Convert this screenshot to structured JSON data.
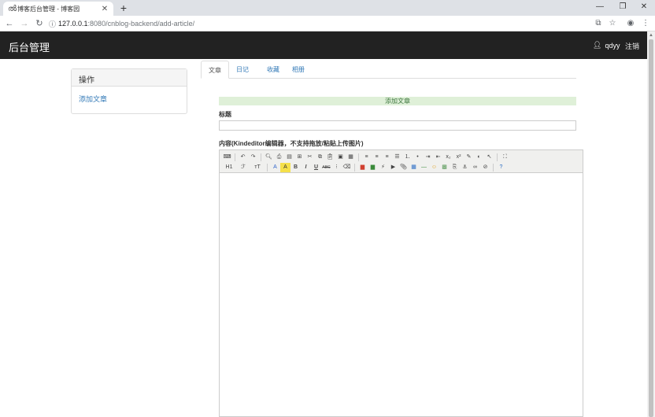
{
  "browser": {
    "tab_title": "博客后台管理 - 博客园",
    "tab_favicon": "cnblog-icon",
    "url_host": "127.0.0.1",
    "url_path": ":8080/cnblog-backend/add-article/",
    "icons": [
      "back-icon",
      "forward-icon",
      "reload-icon",
      "info-icon",
      "translate-icon",
      "star-icon",
      "account-icon",
      "menu-icon"
    ]
  },
  "navbar": {
    "brand": "后台管理",
    "username": "qdyy",
    "logout": "注销"
  },
  "panel": {
    "heading": "操作",
    "link": "添加文章"
  },
  "tabs": [
    "文章",
    "日记",
    "收藏",
    "相册"
  ],
  "form": {
    "banner": "添加文章",
    "title_label": "标题",
    "title_value": "",
    "content_label": "内容(Kindeditor编辑器，不支持拖放/粘贴上传图片)"
  },
  "editor": {
    "toolbar_text": {
      "heading": "H1",
      "font": "ℱ",
      "size": "тT",
      "forecolor": "A",
      "hilite": "A",
      "bold": "B",
      "italic": "I",
      "underline": "U",
      "strike": "ABC"
    }
  },
  "colors": {
    "navbar_bg": "#222222",
    "link": "#337ab7",
    "success_bg": "#dff0d8",
    "success_text": "#3c763d"
  }
}
